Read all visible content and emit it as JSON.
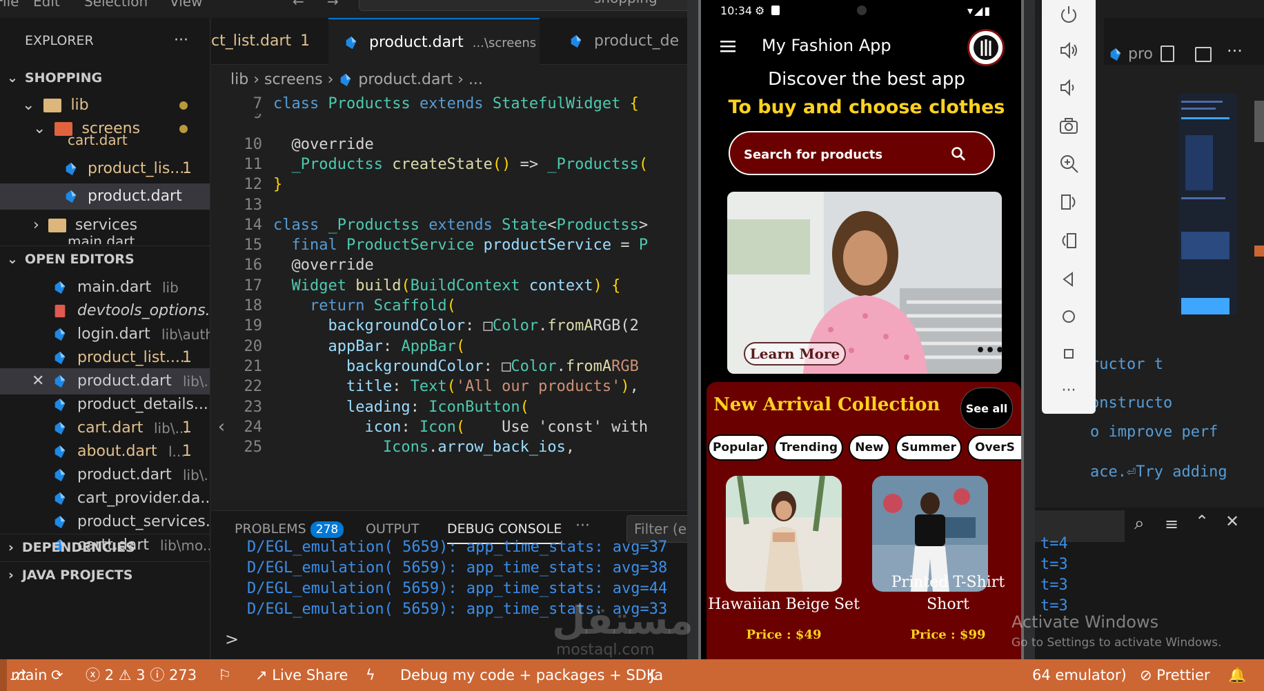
{
  "menu": {
    "items": [
      "File",
      "Edit",
      "Selection",
      "View"
    ],
    "nav": [
      "←",
      "→"
    ],
    "search": "shopping"
  },
  "sidebar": {
    "explorer_title": "EXPLORER",
    "more": "···",
    "workspace": "SHOPPING",
    "tree": [
      {
        "label": "lib"
      },
      {
        "label": "screens"
      },
      {
        "label": "cart.dart",
        "badge": "1"
      },
      {
        "label": "product_lis...",
        "badge": "1"
      },
      {
        "label": "product.dart"
      },
      {
        "label": "services"
      },
      {
        "label": "main.dart"
      }
    ],
    "open_editors_title": "OPEN EDITORS",
    "open_editors": [
      {
        "name": "main.dart",
        "path": "lib",
        "badge": ""
      },
      {
        "name": "devtools_options....",
        "path": "",
        "badge": ""
      },
      {
        "name": "login.dart",
        "path": "lib\\auth",
        "badge": ""
      },
      {
        "name": "product_list....",
        "path": "",
        "badge": "1"
      },
      {
        "name": "product.dart",
        "path": "lib\\...",
        "badge": ""
      },
      {
        "name": "product_details....",
        "path": "",
        "badge": ""
      },
      {
        "name": "cart.dart",
        "path": "lib\\...",
        "badge": "1"
      },
      {
        "name": "about.dart",
        "path": "l...",
        "badge": "1"
      },
      {
        "name": "product.dart",
        "path": "lib\\...",
        "badge": ""
      },
      {
        "name": "cart_provider.da...",
        "path": "",
        "badge": ""
      },
      {
        "name": "product_services....",
        "path": "",
        "badge": ""
      },
      {
        "name": "cartt.dart",
        "path": "lib\\mo...",
        "badge": ""
      }
    ],
    "dependencies": "DEPENDENCIES",
    "java_projects": "JAVA PROJECTS"
  },
  "editor": {
    "tabs": [
      {
        "label": "ct_list.dart",
        "badge": "1"
      },
      {
        "label": "product.dart",
        "path": "...\\screens",
        "close": "✕"
      },
      {
        "label": "product_de"
      }
    ],
    "breadcrumb": [
      "lib",
      "screens",
      "product.dart",
      "..."
    ],
    "lines": [
      {
        "n": "7",
        "tokens": [
          [
            "kw",
            "class "
          ],
          [
            "ty",
            "Productss "
          ],
          [
            "kw",
            "extends "
          ],
          [
            "ty",
            "StatefulWidget "
          ],
          [
            "br",
            "{"
          ]
        ]
      },
      {
        "n": "9",
        "tokens": []
      },
      {
        "n": "10",
        "tokens": [
          [
            "an",
            "  @override"
          ]
        ]
      },
      {
        "n": "11",
        "tokens": [
          [
            "ty",
            "  _Productss "
          ],
          [
            "fn",
            "createState"
          ],
          [
            "br",
            "() "
          ],
          [
            "pl",
            "=> "
          ],
          [
            "ty",
            "_Productss"
          ],
          [
            "br",
            "("
          ]
        ]
      },
      {
        "n": "12",
        "tokens": [
          [
            "br",
            "}"
          ]
        ]
      },
      {
        "n": "13",
        "tokens": []
      },
      {
        "n": "14",
        "tokens": [
          [
            "kw",
            "class "
          ],
          [
            "ty",
            "_Productss "
          ],
          [
            "kw",
            "extends "
          ],
          [
            "ty",
            "State"
          ],
          [
            "pl",
            "<"
          ],
          [
            "ty",
            "Productss"
          ],
          [
            "pl",
            ">"
          ]
        ]
      },
      {
        "n": "15",
        "tokens": [
          [
            "kw",
            "  final "
          ],
          [
            "ty",
            "ProductService "
          ],
          [
            "vr",
            "productService "
          ],
          [
            "pl",
            "= "
          ],
          [
            "ty",
            "P"
          ]
        ]
      },
      {
        "n": "16",
        "tokens": [
          [
            "an",
            "  @override"
          ]
        ]
      },
      {
        "n": "17",
        "tokens": [
          [
            "ty",
            "  Widget "
          ],
          [
            "fn",
            "build"
          ],
          [
            "br",
            "("
          ],
          [
            "ty",
            "BuildContext "
          ],
          [
            "vr",
            "context"
          ],
          [
            "br",
            ") {"
          ]
        ]
      },
      {
        "n": "18",
        "tokens": [
          [
            "kw",
            "    return "
          ],
          [
            "ty",
            "Scaffold"
          ],
          [
            "br",
            "("
          ]
        ]
      },
      {
        "n": "19",
        "tokens": [
          [
            "vr",
            "      backgroundColor"
          ],
          [
            "pl",
            ": □"
          ],
          [
            "ty",
            "Color"
          ],
          [
            "pl",
            "."
          ],
          [
            "fn",
            "fromA"
          ],
          [
            "pl",
            "RGB(2"
          ]
        ]
      },
      {
        "n": "20",
        "tokens": [
          [
            "vr",
            "      appBar"
          ],
          [
            "pl",
            ": "
          ],
          [
            "ty",
            "AppBar"
          ],
          [
            "br",
            "("
          ]
        ]
      },
      {
        "n": "21",
        "tokens": [
          [
            "vr",
            "        backgroundColor"
          ],
          [
            "pl",
            ": □"
          ],
          [
            "ty",
            "Color"
          ],
          [
            "pl",
            "."
          ],
          [
            "fn",
            "fromA"
          ],
          [
            "st",
            "RGB"
          ]
        ]
      },
      {
        "n": "22",
        "tokens": [
          [
            "vr",
            "        title"
          ],
          [
            "pl",
            ": "
          ],
          [
            "ty",
            "Text"
          ],
          [
            "br",
            "("
          ],
          [
            "st",
            "'All our products'"
          ],
          [
            "br",
            ")"
          ],
          [
            "pl",
            ","
          ]
        ]
      },
      {
        "n": "23",
        "tokens": [
          [
            "vr",
            "        leading"
          ],
          [
            "pl",
            ": "
          ],
          [
            "ty",
            "IconButton"
          ],
          [
            "br",
            "("
          ]
        ]
      },
      {
        "n": "24",
        "tokens": [
          [
            "vr",
            "          icon"
          ],
          [
            "pl",
            ": "
          ],
          [
            "ty",
            "Icon"
          ],
          [
            "br",
            "("
          ],
          [
            "pl",
            "    Use 'const' with"
          ]
        ]
      },
      {
        "n": "25",
        "tokens": [
          [
            "ty",
            "            Icons"
          ],
          [
            "pl",
            "."
          ],
          [
            "vr",
            "arrow_back_ios"
          ],
          [
            "pl",
            ","
          ]
        ]
      }
    ]
  },
  "panel": {
    "tabs": [
      {
        "label": "PROBLEMS",
        "badge": "278"
      },
      {
        "label": "OUTPUT"
      },
      {
        "label": "DEBUG CONSOLE"
      },
      {
        "label": "···"
      }
    ],
    "filter_placeholder": "Filter (e",
    "logs": [
      "D/EGL_emulation( 5659): app_time_stats: avg=37",
      "D/EGL_emulation( 5659): app_time_stats: avg=38",
      "D/EGL_emulation( 5659): app_time_stats: avg=44",
      "D/EGL_emulation( 5659): app_time_stats: avg=33"
    ],
    "chevron": ">"
  },
  "right": {
    "code_tab": "pro",
    "lines": [
      "ructor t",
      "onstructo",
      "o improve perf",
      "ace.⏎Try adding"
    ],
    "logs": [
      "t=4",
      "t=3",
      "t=3",
      "t=3"
    ]
  },
  "statusbar": {
    "branch": "main",
    "sync": "⟳",
    "errors": "2",
    "warnings": "3",
    "infos": "273",
    "live_share": "Live Share",
    "debug": "Debug my code + packages + SDK",
    "java": "Ja",
    "emulator": "64 emulator)",
    "prettier": "Prettier",
    "bell": "🔔"
  },
  "phone": {
    "time": "10:34",
    "app_title": "My Fashion App",
    "hero_line1": "Discover the best app",
    "hero_line2": "To buy and choose clothes",
    "search_placeholder": "Search for products",
    "banner_button": "Learn More",
    "arrival_title": "New Arrival Collection",
    "see_all": "See all",
    "chips": [
      "Popular",
      "Trending",
      "New",
      "Summer",
      "OverS"
    ],
    "products": [
      {
        "name_line1": "Hawaiian Beige Set",
        "name_line2": "",
        "price": "Price : $49"
      },
      {
        "name_line1": "Printed T-Shirt",
        "name_line2": "Short",
        "price": "Price : $99"
      }
    ]
  },
  "overlay": {
    "activate_title": "Activate Windows",
    "activate_sub": "Go to Settings to activate Windows.",
    "watermark": "مستقل",
    "watermark_sub": "mostaql.com"
  },
  "colors": {
    "status_bar": "#cc6633",
    "accent": "#0078d4",
    "app_maroon": "#6b0000",
    "app_gold": "#ffd21f"
  }
}
